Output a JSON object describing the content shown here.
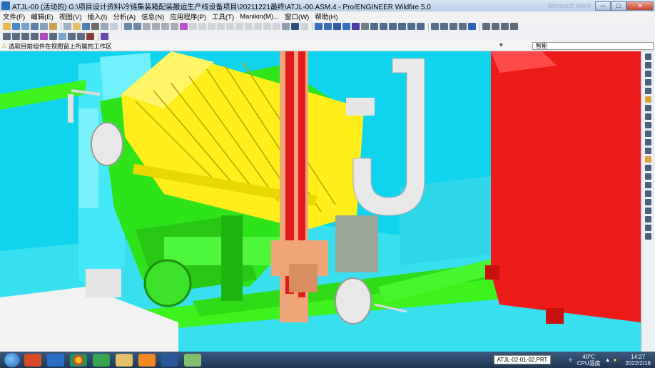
{
  "window": {
    "title": "ATJL-00 (活动的) G:\\项目设计资料\\冷链集装箱配装搬运生产线设备项目\\20211221最终\\ATJL-00.ASM.4 - Pro/ENGINEER Wildfire 5.0",
    "ghost_title": "Microsoft Word",
    "min_label": "─",
    "max_label": "□",
    "close_label": "✕"
  },
  "menu": {
    "items": [
      "文件(F)",
      "编辑(E)",
      "视图(V)",
      "插入(I)",
      "分析(A)",
      "信息(N)",
      "应用程序(P)",
      "工具(T)",
      "Manikin(M)...",
      "窗口(W)",
      "帮助(H)"
    ]
  },
  "message_bar": {
    "message": "选取目前组件在视图窗上所属的工作区",
    "filter_value": "智能"
  },
  "taskbar": {
    "active_file": "ATJL-02-01-02.PRT",
    "temperature": "40℃",
    "temp_label": "CPU温度",
    "time": "14:27",
    "date": "2022/2/16"
  },
  "colors": {
    "viewport_bg": "#10d4ee",
    "frame_cyan": "#3fe6f4",
    "conveyor_green": "#3df21d",
    "gripper_yellow": "#ffee1a",
    "cabinet_red": "#ee1b1b",
    "salmon": "#f0a57a",
    "part_white": "#f2f2f2"
  }
}
